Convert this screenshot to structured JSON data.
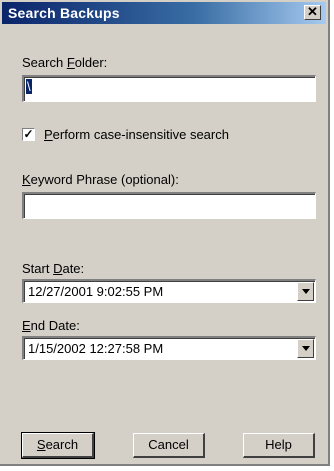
{
  "window": {
    "title": "Search Backups",
    "close_symbol": "✕"
  },
  "search_folder": {
    "label_pre": "Search ",
    "label_key": "F",
    "label_post": "older:",
    "value": "\\"
  },
  "case_insensitive": {
    "label_key": "P",
    "label_post": "erform case-insensitive search",
    "checked": true,
    "check_mark": "✓"
  },
  "keyword": {
    "label_key": "K",
    "label_post": "eyword Phrase (optional):",
    "value": ""
  },
  "start_date": {
    "label_pre": "Start ",
    "label_key": "D",
    "label_post": "ate:",
    "value": "12/27/2001 9:02:55 PM"
  },
  "end_date": {
    "label_key": "E",
    "label_post": "nd Date:",
    "value": "1/15/2002 12:27:58 PM"
  },
  "buttons": {
    "search": {
      "key": "S",
      "rest": "earch"
    },
    "cancel": "Cancel",
    "help": "Help"
  }
}
